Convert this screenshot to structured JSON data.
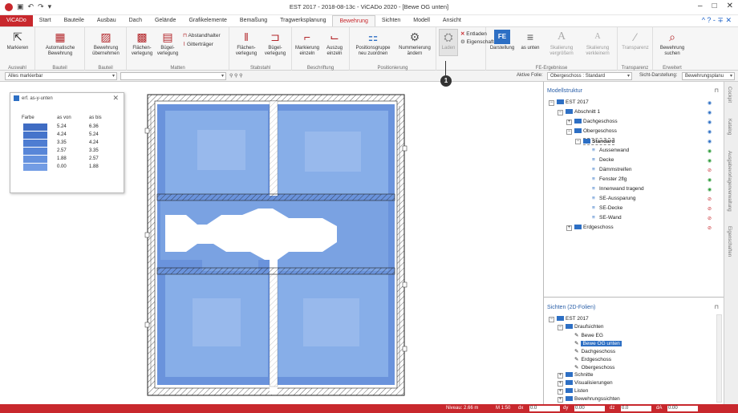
{
  "titlebar": {
    "title": "EST 2017 - 2018-08-13c - ViCADo 2020 - [Bewe OG unten]",
    "win_min": "–",
    "win_max": "□",
    "win_close": "✕",
    "qa_undo": "↶",
    "qa_redo": "↷",
    "qa_more": "▾"
  },
  "menu": {
    "tabs": [
      "ViCADo",
      "Start",
      "Bauteile",
      "Ausbau",
      "Dach",
      "Gelände",
      "Grafikelemente",
      "Bemaßung",
      "Tragwerksplanung",
      "Bewehrung",
      "Sichten",
      "Modell",
      "Ansicht"
    ],
    "active_tab": "Bewehrung",
    "help": "^ ? - ∓ ✕"
  },
  "ribbon": {
    "groups": [
      {
        "label": "Auswahl",
        "buttons": [
          "Markieren"
        ]
      },
      {
        "label": "Bauteil",
        "buttons": [
          "Automatische Bewehrung"
        ]
      },
      {
        "label": "Bauteil",
        "buttons": [
          "Bewehrung übernehmen"
        ]
      },
      {
        "label": "Matten",
        "buttons": [
          "Flächen- verlegung",
          "Bügel- verlegung"
        ],
        "small": [
          "Abstandhalter",
          "Gitterträger"
        ]
      },
      {
        "label": "Stabstahl",
        "buttons": [
          "Flächen- verlegung",
          "Bügel- verlegung"
        ]
      },
      {
        "label": "Beschriftung",
        "buttons": [
          "Markierung einzeln",
          "Auszug einzeln"
        ]
      },
      {
        "label": "Positionierung",
        "buttons": [
          "Positionsgruppe neu zuordnen",
          "Nummerierung ändern"
        ]
      },
      {
        "label": "",
        "buttons": [
          "Laden"
        ],
        "small": [
          "Entladen",
          "Eigenschaften"
        ]
      },
      {
        "label": "FE-Ergebnisse",
        "buttons": [
          "Darstellung",
          "as unten",
          "Skalierung vergrößern",
          "Skalierung verkleinern"
        ]
      },
      {
        "label": "Transparenz",
        "buttons": [
          "Transparenz"
        ]
      },
      {
        "label": "Erweitert",
        "buttons": [
          "Bewehrung suchen"
        ]
      }
    ],
    "fe_badge": "FE"
  },
  "filterbar": {
    "filter_value": "Alles markierbar",
    "folie_label": "Aktive Folie:",
    "folie_value": "Obergeschoss : Standard",
    "sicht_label": "Sicht-Darstellung:",
    "sicht_value": "Bewehrungsplanu"
  },
  "legend": {
    "title": "erf. as-y-unten",
    "close": "✕",
    "headers": [
      "Farbe",
      "as von",
      "as bis"
    ],
    "rows": [
      {
        "color": "#3f6cc3",
        "from": "5.24",
        "to": "6.36"
      },
      {
        "color": "#4574cb",
        "from": "4.24",
        "to": "5.24"
      },
      {
        "color": "#4e7dd2",
        "from": "3.35",
        "to": "4.24"
      },
      {
        "color": "#5886d8",
        "from": "2.57",
        "to": "3.35"
      },
      {
        "color": "#6491de",
        "from": "1.88",
        "to": "2.57"
      },
      {
        "color": "#729ce4",
        "from": "0.00",
        "to": "1.88"
      }
    ]
  },
  "modellstruktur": {
    "title": "Modellstruktur",
    "pin": "⊓",
    "items": [
      "EST 2017",
      "Abschnitt 1",
      "Dachgeschoss",
      "Obergeschoss",
      "Standard",
      "Aussenwand",
      "Decke",
      "Dämmstreifen",
      "Fenster 2flg",
      "Innenwand tragend",
      "SE-Aussparung",
      "SE-Decke",
      "SE-Wand",
      "Erdgeschoss"
    ]
  },
  "sichten": {
    "title": "Sichten (2D-Folien)",
    "pin": "⊓",
    "items": [
      "EST 2017",
      "Draufsichten",
      "Bewe EG",
      "Bewe OG unten",
      "Dachgeschoss",
      "Erdgeschoss",
      "Obergeschoss",
      "Schnitte",
      "Visualisierungen",
      "Listen",
      "Bewehrungssichten"
    ]
  },
  "sidetabs": [
    "Cockpit",
    "Katalog",
    "Ausgabevorlagenverwaltung",
    "Eigenschaften"
  ],
  "statusbar": {
    "niveau": "Niveau: 2.66 m",
    "scale": "M 1:50",
    "x_label": "dx",
    "x_value": "0.0",
    "y_label": "dy",
    "y_value": "0.00",
    "z_label": "dz",
    "z_value": "0.0",
    "a_label": "dA",
    "a_value": "0.00"
  },
  "callout": "1",
  "colors": {
    "brand": "#c8282d",
    "plate_dark": "#6a93dc",
    "plate_light": "#87aee8"
  }
}
